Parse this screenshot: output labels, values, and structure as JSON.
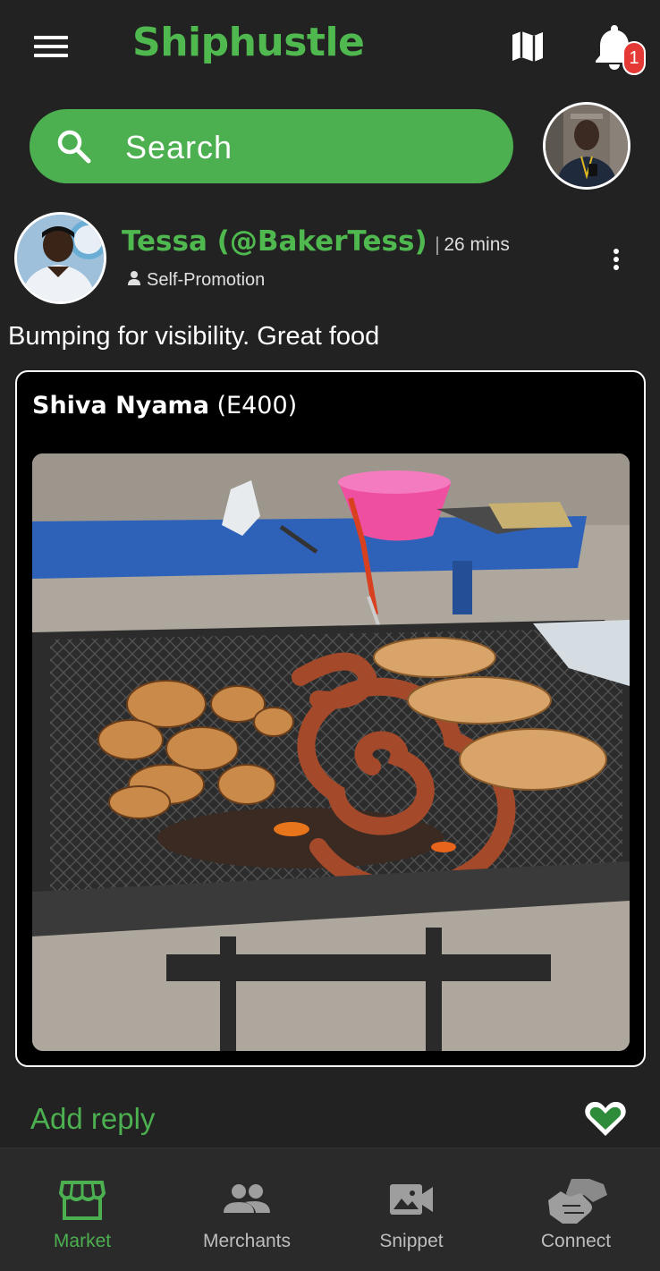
{
  "app": {
    "title": "Shiphustle",
    "accent_color": "#4caf50"
  },
  "header": {
    "menu_icon": "hamburger-menu-icon",
    "map_icon": "map-icon",
    "notifications": {
      "icon": "bell-icon",
      "count": "1"
    }
  },
  "search": {
    "placeholder": "Search",
    "icon": "search-icon"
  },
  "post": {
    "author": "Tessa (@BakerTess)",
    "separator": "|",
    "time": "26 mins",
    "category": "Self-Promotion",
    "text": "Bumping for visibility. Great food",
    "listing": {
      "name": "Shiva Nyama",
      "price": "(E400)"
    }
  },
  "reply": {
    "placeholder": "Add reply"
  },
  "nav": {
    "items": [
      {
        "label": "Market",
        "icon": "storefront-icon",
        "active": true
      },
      {
        "label": "Merchants",
        "icon": "people-icon",
        "active": false
      },
      {
        "label": "Snippet",
        "icon": "video-icon",
        "active": false
      },
      {
        "label": "Connect",
        "icon": "handshake-icon",
        "active": false
      }
    ]
  }
}
